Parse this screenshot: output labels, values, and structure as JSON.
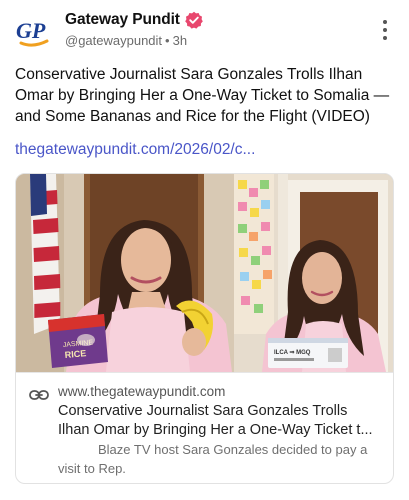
{
  "post": {
    "author": {
      "display_name": "Gateway Pundit",
      "handle": "@gatewaypundit",
      "separator": "•",
      "time_ago": "3h",
      "avatar_text": "GP",
      "verified_icon": "verified-badge-icon",
      "verified_color": "#e8476e"
    },
    "more_icon": "more-vertical-icon",
    "text": "Conservative Journalist Sara Gonzales Trolls Ilhan Omar by Bringing Her a One-Way Ticket to Somalia — and Some Bananas and Rice for the Flight (VIDEO)",
    "link_text": "thegatewaypundit.com/2026/02/c...",
    "link_color": "#4a56c8",
    "card": {
      "image_icon": "article-photo",
      "image_texts": {
        "rice_bag_top": "JASMINE",
        "rice_bag_main": "RICE",
        "ticket": "ILCA ⇒ MGQ"
      },
      "domain": "www.thegatewaypundit.com",
      "title_line1": "Conservative Journalist Sara Gonzales Trolls",
      "title_line2": "Ilhan Omar by Bringing Her a One-Way Ticket t...",
      "description_line1": "Blaze TV host Sara Gonzales decided to pay a",
      "description_line2": "visit to Rep.",
      "link_icon": "link-chain-icon"
    }
  }
}
